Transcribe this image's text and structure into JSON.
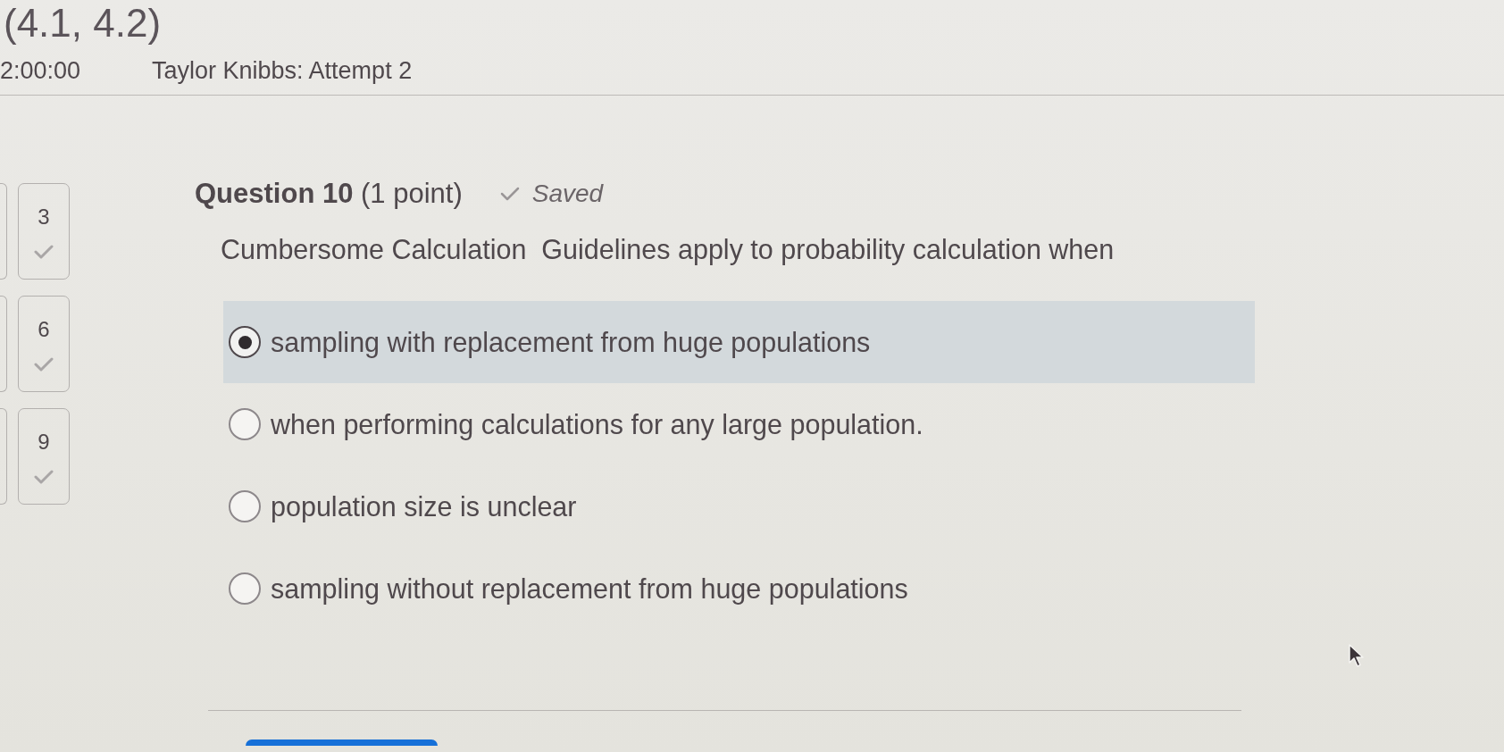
{
  "header": {
    "course_code": "(4.1, 4.2)",
    "timer": "2:00:00",
    "attempt": "Taylor Knibbs: Attempt 2"
  },
  "question_nav": {
    "tiles": [
      {
        "number": "3",
        "answered": true
      },
      {
        "number": "6",
        "answered": true
      },
      {
        "number": "9",
        "answered": true
      }
    ]
  },
  "question": {
    "heading": "**Question 10** (1 point)",
    "status": "Saved",
    "prompt": "Cumbersome Calculation  Guidelines apply to probability calculation when",
    "options": [
      {
        "label": "sampling with replacement from huge populations",
        "selected": true
      },
      {
        "label": "when performing calculations for any large population.",
        "selected": false
      },
      {
        "label": "population size is unclear",
        "selected": false
      },
      {
        "label": "sampling without replacement from huge populations",
        "selected": false
      }
    ]
  }
}
